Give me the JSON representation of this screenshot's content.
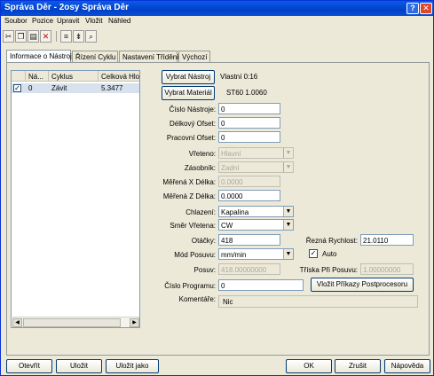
{
  "window": {
    "title": "Správa Děr - 2osy Správa Děr",
    "help_glyph": "?",
    "close_glyph": "✕"
  },
  "menu": [
    "Soubor",
    "Pozice",
    "Upravit",
    "Vložit",
    "Náhled"
  ],
  "toolbar": [
    "scissors-icon",
    "copy-icon",
    "paste-icon",
    "delete-icon",
    "align-icon",
    "sort-icon",
    "preview-icon"
  ],
  "tabs": [
    "Informace o Nástroji",
    "Řízení Cyklu",
    "Nastavení Třídění",
    "Výchozí"
  ],
  "list": {
    "columns": [
      "Ná...",
      "Cyklus",
      "Celková Hlo"
    ],
    "rows": [
      {
        "checked": true,
        "num": "0",
        "cycle": "Závit",
        "depth": "5.3477"
      }
    ]
  },
  "top": {
    "select_tool_button": "Vybrat Nástroj",
    "select_material_button": "Vybrat Materiál",
    "owner_text": "Vlastní 0:16",
    "material_text": "ST60 1.0060"
  },
  "form": {
    "tool_number": {
      "label": "Číslo Nástroje:",
      "value": "0"
    },
    "length_offset": {
      "label": "Délkový Ofset:",
      "value": "0"
    },
    "work_offset": {
      "label": "Pracovní Ofset:",
      "value": "0"
    },
    "spindle": {
      "label": "Vřeteno:",
      "value": "Hlavní"
    },
    "magazine": {
      "label": "Zásobník:",
      "value": "Zadní"
    },
    "measured_x": {
      "label": "Měřená X Délka:",
      "value": "0.0000"
    },
    "measured_z": {
      "label": "Měřená Z Délka:",
      "value": "0.0000"
    },
    "coolant": {
      "label": "Chlazení:",
      "value": "Kapalina"
    },
    "spindle_dir": {
      "label": "Směr Vřetena:",
      "value": "CW"
    },
    "rpm": {
      "label": "Otáčky:",
      "value": "418"
    },
    "cut_speed": {
      "label": "Řezná Rychlost:",
      "value": "21.0110"
    },
    "feed_mode": {
      "label": "Mód Posuvu:",
      "value": "mm/min"
    },
    "auto": {
      "label": "Auto",
      "checked": true
    },
    "feed": {
      "label": "Posuv:",
      "value": "418.00000000"
    },
    "feed_friction": {
      "label": "Tříska Při Posuvu:",
      "value": "1.00000000"
    },
    "program_number": {
      "label": "Číslo Programu:",
      "value": "0"
    },
    "postprocessor_button": "Vložit Příkazy Postprocesoru",
    "comment": {
      "label": "Komentáře:",
      "value": "Nic"
    }
  },
  "bottom": {
    "open": "Otevřít",
    "save": "Uložit",
    "save_as": "Uložit jako",
    "ok": "OK",
    "cancel": "Zrušit",
    "help": "Nápověda"
  }
}
